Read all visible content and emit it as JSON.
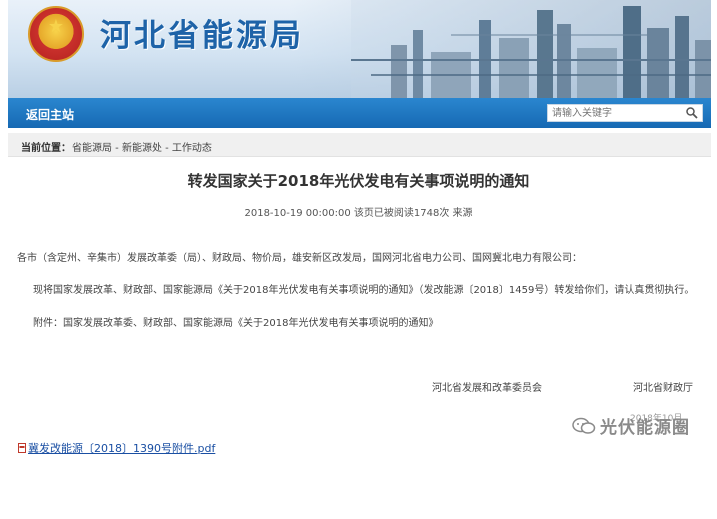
{
  "header": {
    "site_title": "河北省能源局"
  },
  "nav": {
    "home_label": "返回主站",
    "search_placeholder": "请输入关键字"
  },
  "breadcrumb": {
    "label": "当前位置：",
    "path": "省能源局 - 新能源处 - 工作动态"
  },
  "article": {
    "title": "转发国家关于2018年光伏发电有关事项说明的通知",
    "meta": "2018-10-19 00:00:00    该页已被阅读1748次 来源",
    "paragraphs": [
      "各市（含定州、辛集市）发展改革委（局）、财政局、物价局，雄安新区改发局，国网河北省电力公司、国网冀北电力有限公司：",
      "现将国家发展改革、财政部、国家能源局《关于2018年光伏发电有关事项说明的通知》（发改能源〔2018〕1459号）转发给你们，请认真贯彻执行。",
      "附件：国家发展改革委、财政部、国家能源局《关于2018年光伏发电有关事项说明的通知》"
    ],
    "signatures": [
      "河北省发展和改革委员会",
      "河北省财政厅"
    ],
    "attachment": "冀发改能源〔2018〕1390号附件.pdf"
  },
  "watermark": {
    "text": "光伏能源圈",
    "subtext": "2018年10月"
  },
  "colors": {
    "nav_blue": "#1a73bd",
    "title_blue": "#1e63a8",
    "link_blue": "#1a4fa3"
  }
}
